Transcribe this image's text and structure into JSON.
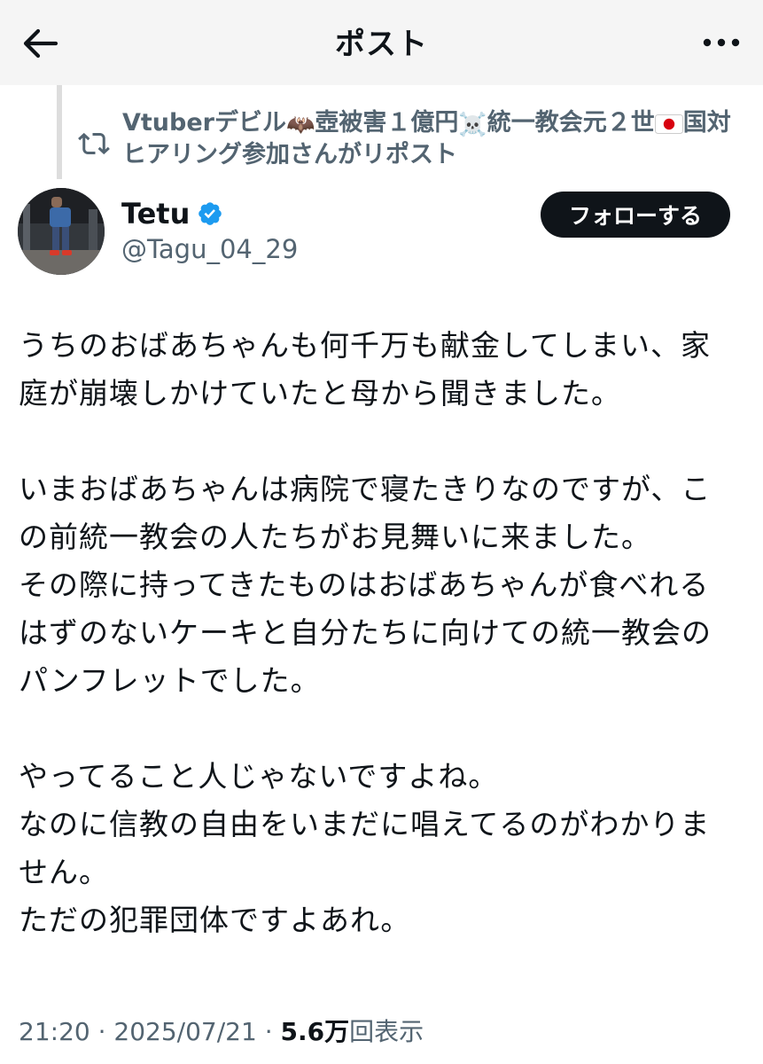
{
  "header": {
    "title": "ポスト"
  },
  "repost": {
    "text_parts": [
      "Vtuberデビル",
      "壺被害１億円",
      "統一教会元２世",
      "国対ヒアリング参加さんがリポスト"
    ],
    "emojis": [
      "bat-emoji",
      "skull-crossbones-emoji",
      "japan-flag-emoji"
    ]
  },
  "author": {
    "display_name": "Tetu",
    "handle": "@Tagu_04_29",
    "verified": true
  },
  "follow_button": {
    "label": "フォローする"
  },
  "post": {
    "paragraphs": [
      [
        "うちのおばあちゃんも何千万も献金してしまい、家",
        "庭が崩壊しかけていたと母から聞きました。"
      ],
      [
        "いまおばあちゃんは病院で寝たきりなのですが、こ",
        "の前統一教会の人たちがお見舞いに来ました。",
        "その際に持ってきたものはおばあちゃんが食べれる",
        "はずのないケーキと自分たちに向けての統一教会の",
        "パンフレットでした。"
      ],
      [
        "やってること人じゃないですよね。",
        "なのに信教の自由をいまだに唱えてるのがわかりま",
        "せん。",
        "ただの犯罪団体ですよあれ。"
      ]
    ]
  },
  "meta": {
    "time": "21:20",
    "separator": "·",
    "date": "2025/07/21",
    "views_count": "5.6万",
    "views_label": "回表示"
  },
  "colors": {
    "text": "#0f1419",
    "secondary": "#536471",
    "verified": "#1d9bf0",
    "header_bg": "#f5f5f5"
  }
}
